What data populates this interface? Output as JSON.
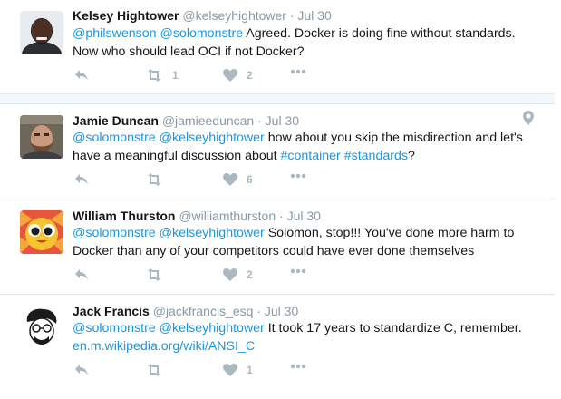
{
  "tweets": [
    {
      "name": "Kelsey Hightower",
      "handle": "@kelseyhightower",
      "time": "· Jul 30",
      "body": [
        {
          "text": "@philswenson",
          "link": true
        },
        {
          "text": " ",
          "link": false
        },
        {
          "text": "@solomonstre",
          "link": true
        },
        {
          "text": " Agreed. Docker is doing fine without standards. Now who should lead OCI if not Docker?",
          "link": false
        }
      ],
      "retweets": "1",
      "likes": "2",
      "icons": {
        "reply": "reply-icon",
        "retweet": "retweet-icon",
        "like": "heart-icon",
        "more": "more-icon"
      }
    },
    {
      "name": "Jamie Duncan",
      "handle": "@jamieeduncan",
      "time": "· Jul 30",
      "body": [
        {
          "text": "@solomonstre",
          "link": true
        },
        {
          "text": " ",
          "link": false
        },
        {
          "text": "@kelseyhightower",
          "link": true
        },
        {
          "text": " how about you skip the misdirection and let's have a meaningful discussion about ",
          "link": false
        },
        {
          "text": "#container",
          "link": true
        },
        {
          "text": " ",
          "link": false
        },
        {
          "text": "#standards",
          "link": true
        },
        {
          "text": "?",
          "link": false
        }
      ],
      "retweets": "",
      "likes": "6",
      "icons": {
        "reply": "reply-icon",
        "retweet": "retweet-icon",
        "like": "heart-icon",
        "more": "more-icon"
      }
    },
    {
      "name": "William Thurston",
      "handle": "@williamthurston",
      "time": "· Jul 30",
      "body": [
        {
          "text": "@solomonstre",
          "link": true
        },
        {
          "text": " ",
          "link": false
        },
        {
          "text": "@kelseyhightower",
          "link": true
        },
        {
          "text": " Solomon, stop!!!  You've done more harm to Docker than any of your competitors could have ever done themselves",
          "link": false
        }
      ],
      "retweets": "",
      "likes": "2",
      "icons": {
        "reply": "reply-icon",
        "retweet": "retweet-icon",
        "like": "heart-icon",
        "more": "more-icon"
      }
    },
    {
      "name": "Jack Francis",
      "handle": "@jackfrancis_esq",
      "time": "· Jul 30",
      "body": [
        {
          "text": "@solomonstre",
          "link": true
        },
        {
          "text": " ",
          "link": false
        },
        {
          "text": "@kelseyhightower",
          "link": true
        },
        {
          "text": " It took 17 years to standardize C, remember. ",
          "link": false
        },
        {
          "text": "en.m.wikipedia.org/wiki/ANSI_C",
          "link": true
        }
      ],
      "retweets": "",
      "likes": "1",
      "icons": {
        "reply": "reply-icon",
        "retweet": "retweet-icon",
        "like": "heart-icon",
        "more": "more-icon"
      }
    }
  ],
  "colors": {
    "link": "#1b95e0",
    "meta": "#8899a6",
    "icon": "#aab8c2",
    "separator": "#e1e8ed"
  },
  "geo_icon": "location-pin-icon"
}
